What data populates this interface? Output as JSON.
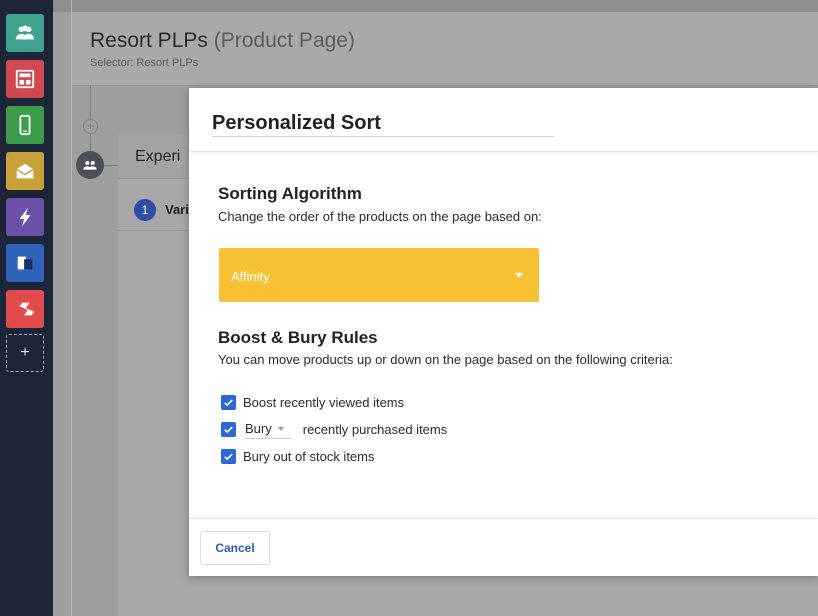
{
  "sidebar": {
    "apps": [
      {
        "icon": "people-icon",
        "color": "#3fa38e"
      },
      {
        "icon": "layout-icon",
        "color": "#cf4a4f"
      },
      {
        "icon": "mobile-icon",
        "color": "#3d9c4a"
      },
      {
        "icon": "email-icon",
        "color": "#c8a13a"
      },
      {
        "icon": "bolt-icon",
        "color": "#6a52a8"
      },
      {
        "icon": "blocks-icon",
        "color": "#2f62b8"
      },
      {
        "icon": "s-logo-icon",
        "color": "#e24b4b"
      }
    ],
    "add_label": "+"
  },
  "page": {
    "title": "Resort PLPs",
    "title_suffix": "(Product Page)",
    "selector": "Selector: Resort PLPs"
  },
  "experience": {
    "title": "Experi",
    "variant_number": "1",
    "variant_label": "Vari"
  },
  "modal": {
    "title": "Personalized Sort",
    "sorting": {
      "title": "Sorting Algorithm",
      "description": "Change the order of the products on the page based on:",
      "selected": "Affinity"
    },
    "boost_bury": {
      "title": "Boost & Bury Rules",
      "description": "You can move products up or down on the page based on the following criteria:",
      "rule1": "Boost recently viewed items",
      "rule2_action": "Bury",
      "rule2_text": "recently purchased items",
      "rule3": "Bury out of stock items"
    },
    "cancel_label": "Cancel"
  }
}
